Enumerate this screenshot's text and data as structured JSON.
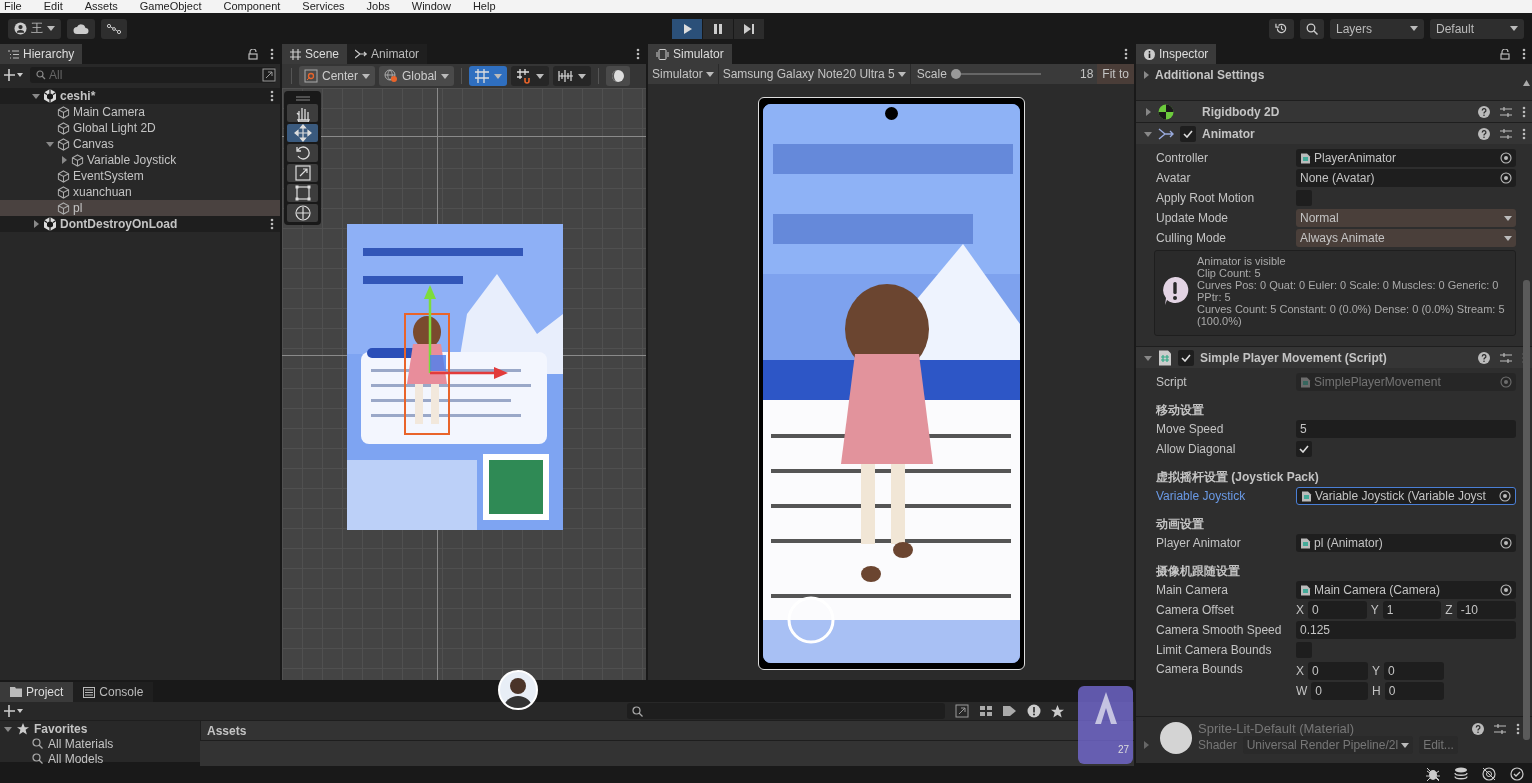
{
  "menu": [
    "File",
    "Edit",
    "Assets",
    "GameObject",
    "Component",
    "Services",
    "Jobs",
    "Window",
    "Help"
  ],
  "toolbar": {
    "account": "王",
    "play_controls": [
      {
        "kind": "play",
        "on": true
      },
      {
        "kind": "pause",
        "on": false
      },
      {
        "kind": "step",
        "on": false
      }
    ],
    "layers": "Layers",
    "layout": "Default"
  },
  "hierarchy": {
    "tab": "Hierarchy",
    "search_placeholder": "All",
    "scenes": [
      {
        "name": "ceshi*",
        "expanded": true,
        "children": [
          {
            "name": "Main Camera",
            "selected": false
          },
          {
            "name": "Global Light 2D",
            "selected": false
          },
          {
            "name": "Canvas",
            "selected": false,
            "expanded": true,
            "children": [
              {
                "name": "Variable Joystick",
                "selected": false,
                "expanded": false
              }
            ]
          },
          {
            "name": "EventSystem",
            "selected": false
          },
          {
            "name": "xuanchuan",
            "selected": false
          },
          {
            "name": "pl",
            "selected": true
          }
        ]
      },
      {
        "name": "DontDestroyOnLoad",
        "expanded": false
      }
    ]
  },
  "scene": {
    "tabs": [
      {
        "label": "Scene",
        "kind": "scene",
        "selected": true
      },
      {
        "label": "Animator",
        "kind": "animator",
        "selected": false
      }
    ],
    "pivot": "Center",
    "space": "Global",
    "toggles": [
      {
        "kind": "grid",
        "on": true
      },
      {
        "kind": "snap",
        "on": false
      },
      {
        "kind": "increment",
        "on": false
      }
    ],
    "tools": [
      {
        "kind": "hand",
        "selected": false
      },
      {
        "kind": "move",
        "selected": true
      },
      {
        "kind": "rotate",
        "selected": false
      },
      {
        "kind": "scale",
        "selected": false
      },
      {
        "kind": "rect",
        "selected": false
      },
      {
        "kind": "transform",
        "selected": false
      }
    ]
  },
  "simulator": {
    "tab": "Simulator",
    "mode": "Simulator",
    "device": "Samsung Galaxy Note20 Ultra 5",
    "scale_label": "Scale",
    "scale": {
      "level": 0.04,
      "reading": "18"
    },
    "fit": "Fit to"
  },
  "inspector": {
    "tab": "Inspector",
    "section": "Additional Settings",
    "components": [
      {
        "name": "Rigidbody 2D",
        "kind": "rigidbody",
        "expanded": false
      },
      {
        "name": "Animator",
        "kind": "animator",
        "expanded": true,
        "enabled": true,
        "fields": [
          {
            "kind": "asset",
            "label": "Controller",
            "value": "PlayerAnimator",
            "focused": false
          },
          {
            "kind": "object",
            "label": "Avatar",
            "value": "None (Avatar)",
            "focused": false
          },
          {
            "kind": "checkbox",
            "label": "Apply Root Motion",
            "checked": false
          },
          {
            "kind": "dropdown",
            "label": "Update Mode",
            "value": "Normal"
          },
          {
            "kind": "dropdown",
            "label": "Culling Mode",
            "value": "Always Animate"
          },
          {
            "kind": "info",
            "lines": [
              "Animator is visible",
              "Clip Count: 5",
              "Curves Pos: 0 Quat: 0 Euler: 0 Scale: 0 Muscles: 0 Generic: 0",
              "PPtr: 5",
              "Curves Count: 5 Constant: 0 (0.0%) Dense: 0 (0.0%) Stream: 5",
              "(100.0%)"
            ]
          }
        ]
      },
      {
        "name": "Simple Player Movement (Script)",
        "kind": "script",
        "expanded": true,
        "enabled": true,
        "fields": [
          {
            "kind": "asset",
            "label": "Script",
            "value": "SimplePlayerMovement",
            "focused": false,
            "disabled": true
          },
          {
            "kind": "header",
            "label": "移动设置"
          },
          {
            "kind": "text",
            "label": "Move Speed",
            "value": "5"
          },
          {
            "kind": "checkbox",
            "label": "Allow Diagonal",
            "checked": true
          },
          {
            "kind": "header",
            "label": "虚拟摇杆设置 (Joystick Pack)"
          },
          {
            "kind": "asset",
            "label": "Variable Joystick",
            "value": "Variable Joystick (Variable Joyst",
            "focused": true
          },
          {
            "kind": "header",
            "label": "动画设置"
          },
          {
            "kind": "asset",
            "label": "Player Animator",
            "value": "pl (Animator)",
            "focused": false
          },
          {
            "kind": "header",
            "label": "摄像机跟随设置"
          },
          {
            "kind": "asset",
            "label": "Main Camera",
            "value": "Main Camera (Camera)",
            "focused": false
          },
          {
            "kind": "vector",
            "label": "Camera Offset",
            "axes": [
              {
                "axis": "X",
                "value": "0"
              },
              {
                "axis": "Y",
                "value": "1"
              },
              {
                "axis": "Z",
                "value": "-10"
              }
            ]
          },
          {
            "kind": "text",
            "label": "Camera Smooth Speed",
            "value": "0.125"
          },
          {
            "kind": "checkbox",
            "label": "Limit Camera Bounds",
            "checked": false
          },
          {
            "kind": "rect",
            "label": "Camera Bounds",
            "axes": [
              {
                "axis": "X",
                "value": "0"
              },
              {
                "axis": "Y",
                "value": "0"
              },
              {
                "axis": "W",
                "value": "0"
              },
              {
                "axis": "H",
                "value": "0"
              }
            ]
          }
        ]
      }
    ],
    "material": {
      "name": "Sprite-Lit-Default (Material)",
      "expanded": false,
      "shader_label": "Shader",
      "shader": "Universal Render Pipeline/2l",
      "edit": "Edit..."
    }
  },
  "project": {
    "tabs": [
      {
        "label": "Project",
        "kind": "project",
        "selected": true
      },
      {
        "label": "Console",
        "kind": "console",
        "selected": false
      }
    ],
    "favorites": {
      "label": "Favorites",
      "expanded": true,
      "items": [
        "All Materials",
        "All Models"
      ]
    },
    "assets_header": "Assets",
    "badge": "27"
  }
}
